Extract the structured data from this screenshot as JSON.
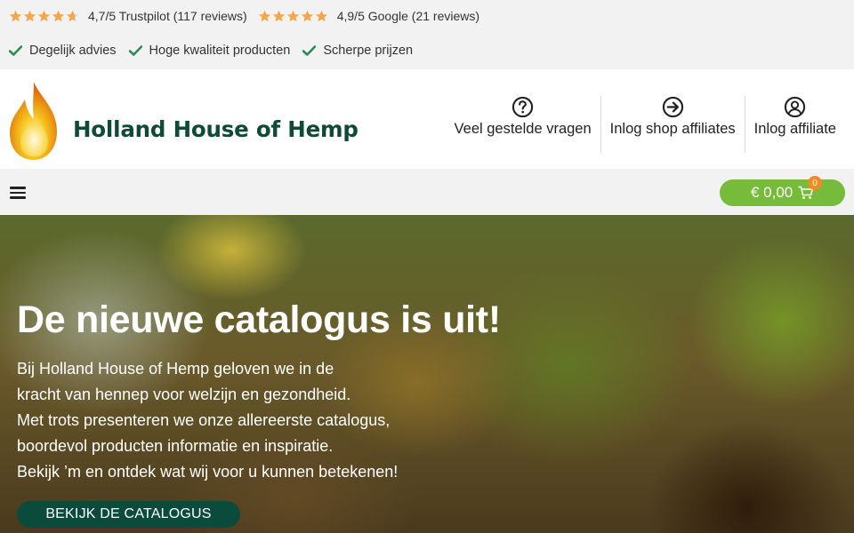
{
  "ratings": {
    "trustpilot_text": "4,7/5 Trustpilot (117 reviews)",
    "trustpilot_stars": 4.7,
    "google_text": "4,9/5 Google (21 reviews)",
    "google_stars": 4.9,
    "star_color": "#f3a64a"
  },
  "usps": [
    "Degelijk advies",
    "Hoge kwaliteit producten",
    "Scherpe prijzen"
  ],
  "usp_check_color": "#2e8b57",
  "brand": {
    "name": "Holland House of Hemp",
    "color": "#0e4a35"
  },
  "nav": {
    "faq": "Veel gestelde vragen",
    "shop_affiliates": "Inlog shop affiliates",
    "affiliate_login": "Inlog affiliate"
  },
  "cart": {
    "total": "€ 0,00",
    "count": "0",
    "color": "#76bb3a",
    "badge_color": "#f08a24"
  },
  "hero": {
    "title": "De nieuwe catalogus is uit!",
    "lines": [
      "Bij Holland House of Hemp geloven we in de",
      "kracht van hennep voor welzijn en gezondheid.",
      "Met trots presenteren we onze allereerste catalogus,",
      "boordevol producten informatie en inspiratie.",
      "Bekijk ’m en ontdek wat wij voor u kunnen betekenen!"
    ],
    "cta": "BEKIJK DE CATALOGUS",
    "cta_color": "#0b4b3c"
  },
  "icons": {
    "faq": "question-circle-icon",
    "shop_affiliates": "arrow-circle-right-icon",
    "affiliate_login": "user-circle-icon",
    "menu": "hamburger-menu-icon",
    "cart": "shopping-cart-icon"
  }
}
